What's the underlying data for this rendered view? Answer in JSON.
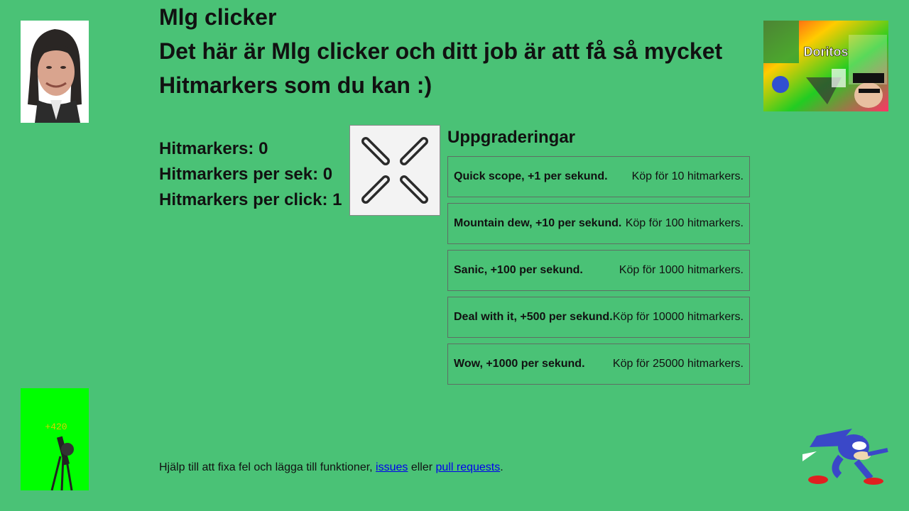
{
  "header": {
    "title": "Mlg clicker",
    "intro": "Det här är Mlg clicker och ditt job är att få så mycket Hitmarkers som du kan :)"
  },
  "stats": {
    "hitmarkers": "Hitmarkers: 0",
    "per_sec": "Hitmarkers per sek: 0",
    "per_click": "Hitmarkers per click: 1"
  },
  "upgrades": {
    "heading": "Uppgraderingar",
    "items": [
      {
        "name": "Quick scope, +1 per sekund.",
        "cost": "Köp för 10 hitmarkers."
      },
      {
        "name": "Mountain dew, +10 per sekund.",
        "cost": "Köp för 100 hitmarkers."
      },
      {
        "name": "Sanic, +100 per sekund.",
        "cost": "Köp för 1000 hitmarkers."
      },
      {
        "name": "Deal with it, +500 per sekund.",
        "cost": "Köp för 10000 hitmarkers."
      },
      {
        "name": "Wow, +1000 per sekund.",
        "cost": "Köp för 25000 hitmarkers."
      }
    ]
  },
  "images": {
    "meme_label": "Doritos",
    "gun_label": "+420"
  },
  "footer": {
    "text_before": "Hjälp till att fixa fel och lägga till funktioner, ",
    "link_issues": "issues",
    "text_middle": " eller ",
    "link_prs": "pull requests",
    "text_after": "."
  },
  "colors": {
    "background": "#4ac276",
    "link": "#0000ee",
    "border": "#5e6e64"
  }
}
